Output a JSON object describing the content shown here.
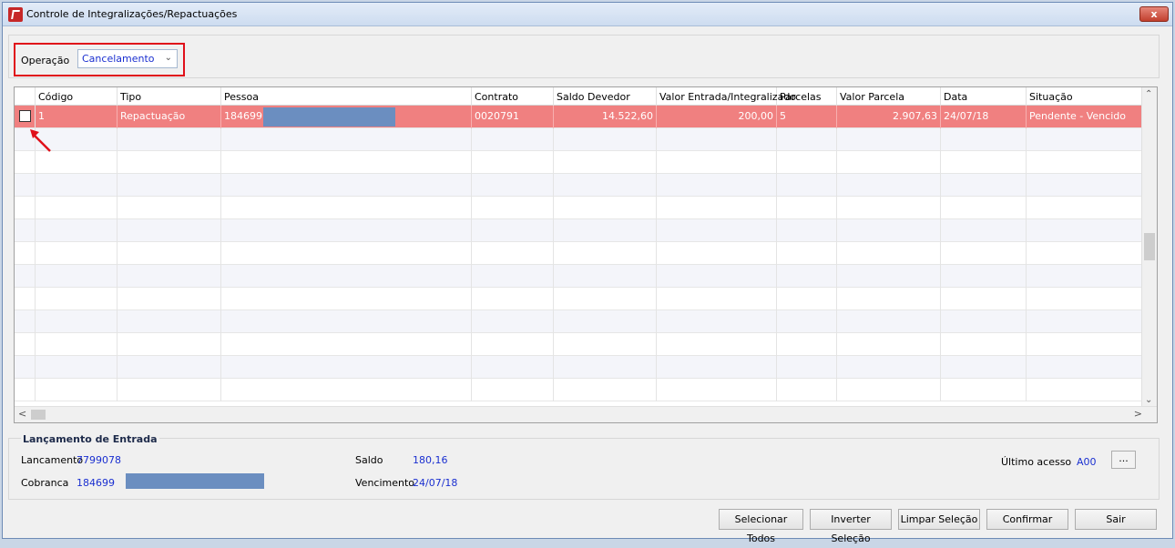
{
  "window": {
    "title": "Controle de Integralizações/Repactuações",
    "close_glyph": "x"
  },
  "operation": {
    "label": "Operação",
    "value": "Cancelamento"
  },
  "grid": {
    "columns": [
      "Código",
      "Tipo",
      "Pessoa",
      "Contrato",
      "Saldo Devedor",
      "Valor Entrada/Integralizado",
      "Parcelas",
      "Valor Parcela",
      "Data",
      "Situação"
    ],
    "rows": [
      {
        "codigo": "1",
        "tipo": "Repactuação",
        "pessoa": "184699",
        "contrato": "0020791",
        "saldo_devedor": "14.522,60",
        "valor_entrada": "200,00",
        "parcelas": "5",
        "valor_parcela": "2.907,63",
        "data": "24/07/18",
        "situacao": "Pendente - Vencido"
      }
    ],
    "selected_row_color": "#f08080"
  },
  "entry": {
    "section_title": "Lançamento de Entrada",
    "lancamento_label": "Lancamento",
    "lancamento_value": "7799078",
    "cobranca_label": "Cobranca",
    "cobranca_value": "184699",
    "saldo_label": "Saldo",
    "saldo_value": "180,16",
    "vencimento_label": "Vencimento",
    "vencimento_value": "24/07/18",
    "ultimo_acesso_label": "Último acesso",
    "ultimo_acesso_value": "A00",
    "more_button": "..."
  },
  "buttons": {
    "selecionar_todos": "Selecionar Todos",
    "inverter_selecao": "Inverter Seleção",
    "limpar_selecao": "Limpar Seleção",
    "confirmar": "Confirmar",
    "sair": "Sair"
  }
}
